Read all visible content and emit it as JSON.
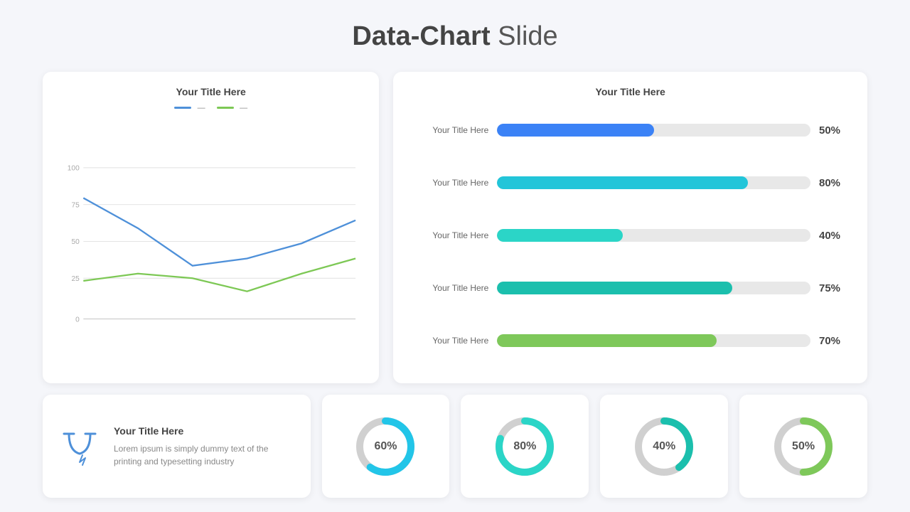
{
  "page": {
    "title_normal": " Slide",
    "title_bold": "Data-Chart"
  },
  "line_chart": {
    "card_title": "Your Title Here",
    "legend": [
      {
        "color": "#4e90d9",
        "label": "—"
      },
      {
        "color": "#7dc855",
        "label": "—"
      }
    ],
    "y_labels": [
      "100",
      "75",
      "50",
      "25",
      "0"
    ],
    "blue_points": [
      [
        0,
        80
      ],
      [
        1,
        60
      ],
      [
        2,
        35
      ],
      [
        3,
        40
      ],
      [
        4,
        50
      ],
      [
        5,
        65
      ]
    ],
    "green_points": [
      [
        0,
        25
      ],
      [
        1,
        30
      ],
      [
        2,
        27
      ],
      [
        3,
        18
      ],
      [
        4,
        30
      ],
      [
        5,
        40
      ]
    ]
  },
  "bar_chart": {
    "card_title": "Your Title Here",
    "rows": [
      {
        "label": "Your Title Here",
        "pct": 50,
        "color": "#3b82f6"
      },
      {
        "label": "Your Title Here",
        "pct": 80,
        "color": "#22c5d9"
      },
      {
        "label": "Your Title Here",
        "pct": 40,
        "color": "#2bd5c7"
      },
      {
        "label": "Your Title Here",
        "pct": 75,
        "color": "#1bbfad"
      },
      {
        "label": "Your Title Here",
        "pct": 70,
        "color": "#7ec85a"
      }
    ]
  },
  "info_card": {
    "title": "Your Title Here",
    "desc": "Lorem ipsum is simply dummy text of the printing and typesetting industry"
  },
  "donuts": [
    {
      "pct": 60,
      "label": "60%",
      "color": "#22c5e8",
      "track": "#d0d0d0"
    },
    {
      "pct": 80,
      "label": "80%",
      "color": "#2bd5c7",
      "track": "#d0d0d0"
    },
    {
      "pct": 40,
      "label": "40%",
      "color": "#1bbfad",
      "track": "#d0d0d0"
    },
    {
      "pct": 50,
      "label": "50%",
      "color": "#7ec85a",
      "track": "#d0d0d0"
    }
  ]
}
